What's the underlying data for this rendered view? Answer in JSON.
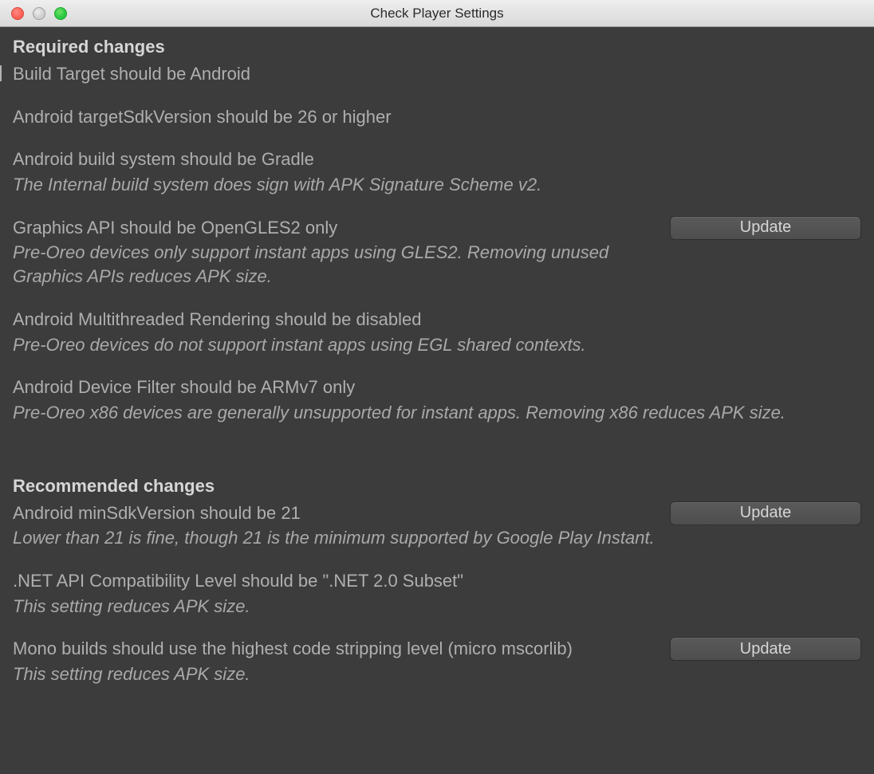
{
  "window": {
    "title": "Check Player Settings"
  },
  "sections": {
    "required": {
      "header": "Required changes",
      "items": {
        "build_target": {
          "title": "Build Target should be Android"
        },
        "target_sdk": {
          "title": "Android targetSdkVersion should be 26 or higher"
        },
        "build_system": {
          "title": "Android build system should be Gradle",
          "desc": "The Internal build system does sign with APK Signature Scheme v2."
        },
        "graphics_api": {
          "title": "Graphics API should be OpenGLES2 only",
          "desc": "Pre-Oreo devices only support instant apps using GLES2. Removing unused Graphics APIs reduces APK size.",
          "button": "Update"
        },
        "multithreaded": {
          "title": "Android Multithreaded Rendering should be disabled",
          "desc": "Pre-Oreo devices do not support instant apps using EGL shared contexts."
        },
        "device_filter": {
          "title": "Android Device Filter should be ARMv7 only",
          "desc": "Pre-Oreo x86 devices are generally unsupported for instant apps. Removing x86 reduces APK size."
        }
      }
    },
    "recommended": {
      "header": "Recommended changes",
      "items": {
        "min_sdk": {
          "title": "Android minSdkVersion should be 21",
          "desc": "Lower than 21 is fine, though 21 is the minimum supported by Google Play Instant.",
          "button": "Update"
        },
        "net_compat": {
          "title": ".NET API Compatibility Level should be \".NET 2.0 Subset\"",
          "desc": "This setting reduces APK size."
        },
        "mono_strip": {
          "title": "Mono builds should use the highest code stripping level (micro mscorlib)",
          "desc": "This setting reduces APK size.",
          "button": "Update"
        }
      }
    }
  }
}
